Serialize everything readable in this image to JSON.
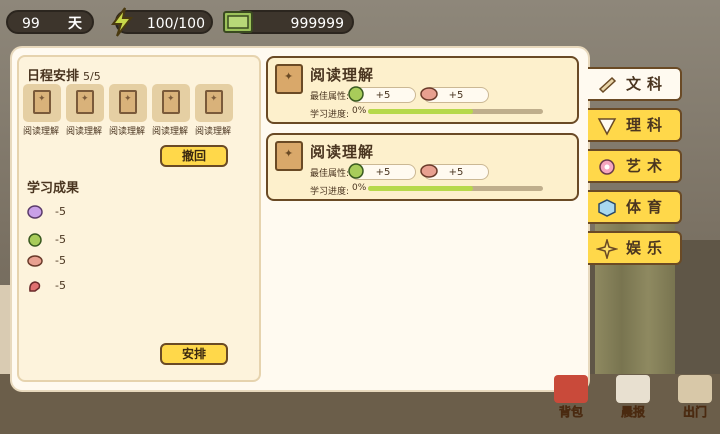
{
  "status": {
    "days_value": "99",
    "days_unit": "天",
    "energy": "100/100",
    "money": "999999"
  },
  "schedule": {
    "title": "日程安排",
    "count": "5/5",
    "slots": [
      {
        "label": "阅读理解"
      },
      {
        "label": "阅读理解"
      },
      {
        "label": "阅读理解"
      },
      {
        "label": "阅读理解"
      },
      {
        "label": "阅读理解"
      }
    ],
    "undo_label": "撤回",
    "arrange_label": "安排"
  },
  "results": {
    "title": "学习成果",
    "items": [
      {
        "icon": "brain-icon",
        "value": "-5",
        "color": "#c9a0e8"
      },
      {
        "icon": "cabbage-icon",
        "value": "-5",
        "color": "#a8cc5a"
      },
      {
        "icon": "meat-icon",
        "value": "-5",
        "color": "#e8a090"
      },
      {
        "icon": "muscle-icon",
        "value": "-5",
        "color": "#e07070"
      }
    ]
  },
  "courses": [
    {
      "title": "阅读理解",
      "best_attr_label": "最佳属性:",
      "attr1": "+5",
      "attr2": "+5",
      "progress_label": "学习进度:",
      "progress_text": "0%",
      "progress_fill": 0.6
    },
    {
      "title": "阅读理解",
      "best_attr_label": "最佳属性:",
      "attr1": "+5",
      "attr2": "+5",
      "progress_label": "学习进度:",
      "progress_text": "0%",
      "progress_fill": 0.6
    }
  ],
  "tabs": [
    {
      "label": "文科",
      "icon": "scroll-icon",
      "active": true
    },
    {
      "label": "理科",
      "icon": "triangle-ruler-icon",
      "active": false
    },
    {
      "label": "艺术",
      "icon": "flower-icon",
      "active": false
    },
    {
      "label": "体育",
      "icon": "cube-icon",
      "active": false
    },
    {
      "label": "娱乐",
      "icon": "star-icon",
      "active": false
    }
  ],
  "bottom": {
    "bag_label": "背包",
    "report_label": "晨报",
    "go_out_label": "出门"
  },
  "colors": {
    "accent": "#ffd84a",
    "card_bg": "#fdf0cc",
    "progress": "#b7d94a"
  }
}
